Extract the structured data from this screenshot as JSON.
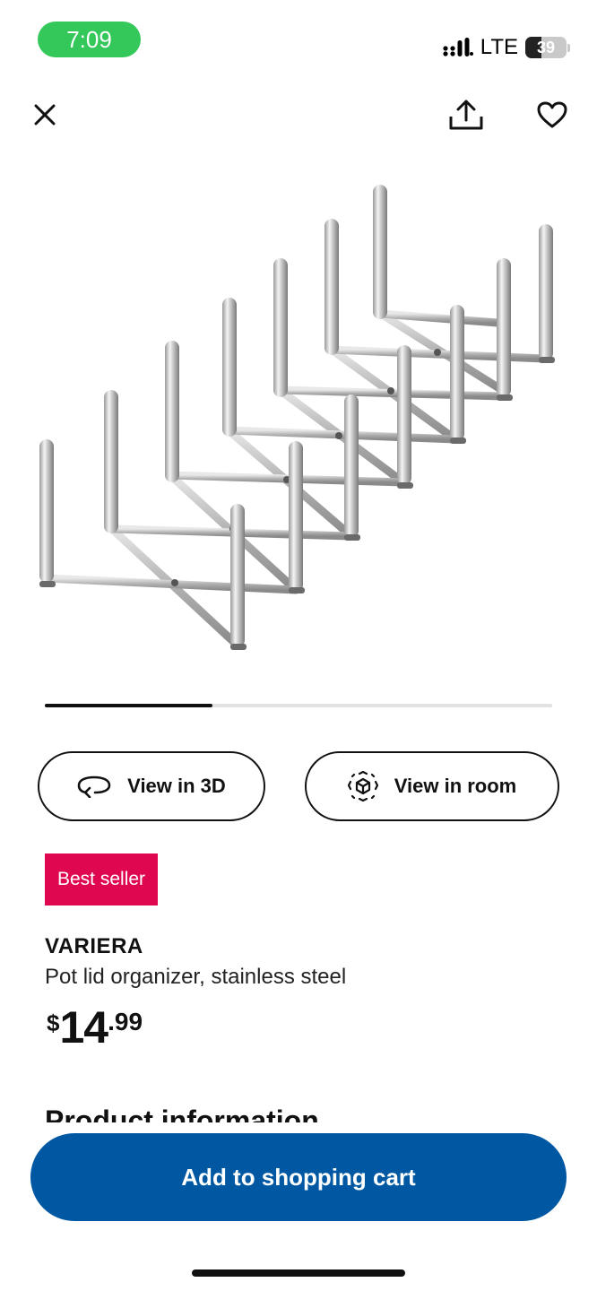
{
  "status_bar": {
    "time": "7:09",
    "network": "LTE",
    "battery": "39",
    "battery_fraction": 0.39,
    "time_pill_color": "#34c759"
  },
  "nav": {
    "close_icon": "close-icon",
    "share_icon": "share-icon",
    "favorite_icon": "heart-icon"
  },
  "carousel": {
    "progress": 0.33
  },
  "actions": {
    "view_3d_label": "View in 3D",
    "view_room_label": "View in room"
  },
  "product": {
    "badge": "Best seller",
    "badge_color": "#e00751",
    "name": "VARIERA",
    "description": "Pot lid organizer, stainless steel",
    "price_currency": "$",
    "price_integer": "14",
    "price_decimal": ".99"
  },
  "section": {
    "title": "Product information"
  },
  "cart": {
    "label": "Add to shopping cart",
    "color": "#0058a3"
  }
}
